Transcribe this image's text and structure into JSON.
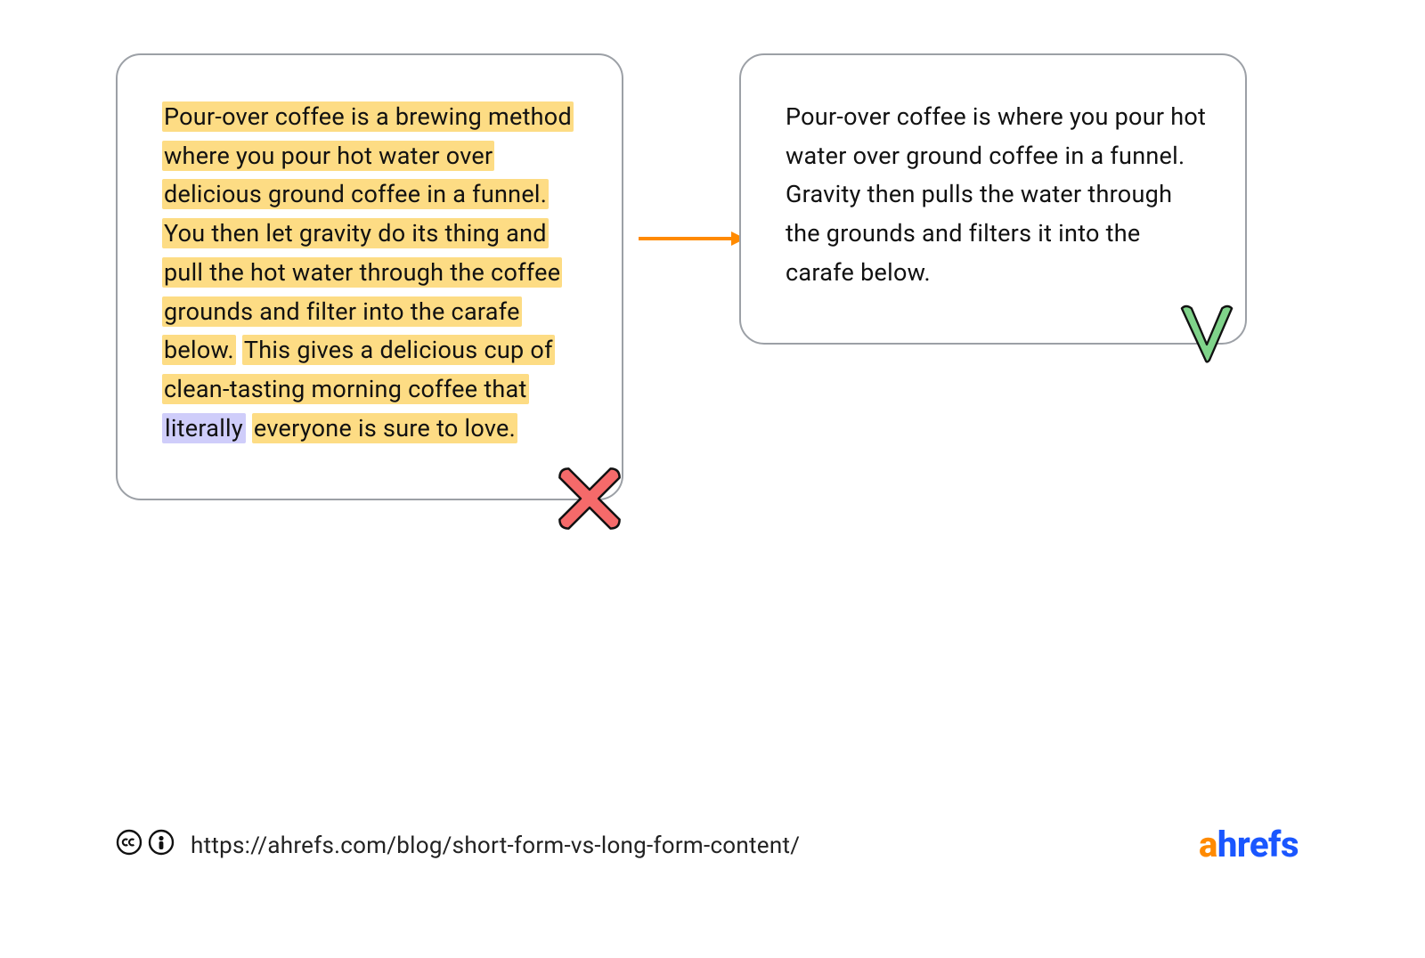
{
  "bad": {
    "seg1": "Pour-over coffee is a brewing method where you pour hot water over delicious ground coffee in a funnel.",
    "seg2": "You then let gravity do its thing and pull the hot water through the coffee grounds and filter into the carafe below.",
    "seg3a": "This gives a delicious cup of clean-tasting morning coffee that",
    "seg3_word": "literally",
    "seg3b": "everyone is sure to love."
  },
  "good": {
    "text": "Pour-over coffee is where you pour hot water over ground coffee in a funnel. Gravity then pulls the water through the grounds and filters it into the carafe below."
  },
  "footer": {
    "url": "https://ahrefs.com/blog/short-form-vs-long-form-content/"
  },
  "brand": {
    "a": "a",
    "rest": "hrefs"
  },
  "colors": {
    "highlight_yellow": "#fddc84",
    "highlight_purple": "#cfcdfa",
    "arrow": "#ff8a00",
    "cross": "#f56a6a",
    "check": "#7fd38a",
    "brand_orange": "#ff8a00",
    "brand_blue": "#1a56ff"
  }
}
